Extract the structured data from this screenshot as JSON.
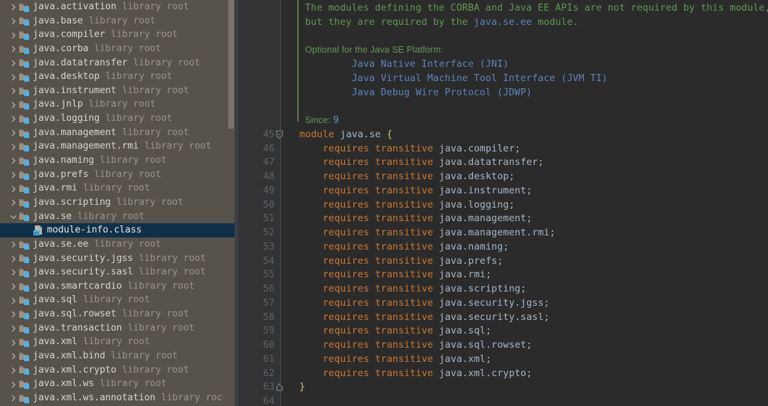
{
  "sidebar": {
    "tree": [
      {
        "name": "java.activation",
        "sub": "library root",
        "expanded": false,
        "icon": "library-root-icon",
        "selected": false,
        "child": false
      },
      {
        "name": "java.base",
        "sub": "library root",
        "expanded": false,
        "icon": "library-root-icon",
        "selected": false,
        "child": false
      },
      {
        "name": "java.compiler",
        "sub": "library root",
        "expanded": false,
        "icon": "library-root-icon",
        "selected": false,
        "child": false
      },
      {
        "name": "java.corba",
        "sub": "library root",
        "expanded": false,
        "icon": "library-root-icon",
        "selected": false,
        "child": false
      },
      {
        "name": "java.datatransfer",
        "sub": "library root",
        "expanded": false,
        "icon": "library-root-icon",
        "selected": false,
        "child": false
      },
      {
        "name": "java.desktop",
        "sub": "library root",
        "expanded": false,
        "icon": "library-root-icon",
        "selected": false,
        "child": false
      },
      {
        "name": "java.instrument",
        "sub": "library root",
        "expanded": false,
        "icon": "library-root-icon",
        "selected": false,
        "child": false
      },
      {
        "name": "java.jnlp",
        "sub": "library root",
        "expanded": false,
        "icon": "library-root-icon",
        "selected": false,
        "child": false
      },
      {
        "name": "java.logging",
        "sub": "library root",
        "expanded": false,
        "icon": "library-root-icon",
        "selected": false,
        "child": false
      },
      {
        "name": "java.management",
        "sub": "library root",
        "expanded": false,
        "icon": "library-root-icon",
        "selected": false,
        "child": false
      },
      {
        "name": "java.management.rmi",
        "sub": "library root",
        "expanded": false,
        "icon": "library-root-icon",
        "selected": false,
        "child": false
      },
      {
        "name": "java.naming",
        "sub": "library root",
        "expanded": false,
        "icon": "library-root-icon",
        "selected": false,
        "child": false
      },
      {
        "name": "java.prefs",
        "sub": "library root",
        "expanded": false,
        "icon": "library-root-icon",
        "selected": false,
        "child": false
      },
      {
        "name": "java.rmi",
        "sub": "library root",
        "expanded": false,
        "icon": "library-root-icon",
        "selected": false,
        "child": false
      },
      {
        "name": "java.scripting",
        "sub": "library root",
        "expanded": false,
        "icon": "library-root-icon",
        "selected": false,
        "child": false
      },
      {
        "name": "java.se",
        "sub": "library root",
        "expanded": true,
        "icon": "library-root-icon",
        "selected": false,
        "child": false
      },
      {
        "name": "module-info.class",
        "sub": "",
        "expanded": null,
        "icon": "class-file-icon",
        "selected": true,
        "child": true
      },
      {
        "name": "java.se.ee",
        "sub": "library root",
        "expanded": false,
        "icon": "library-root-icon",
        "selected": false,
        "child": false
      },
      {
        "name": "java.security.jgss",
        "sub": "library root",
        "expanded": false,
        "icon": "library-root-icon",
        "selected": false,
        "child": false
      },
      {
        "name": "java.security.sasl",
        "sub": "library root",
        "expanded": false,
        "icon": "library-root-icon",
        "selected": false,
        "child": false
      },
      {
        "name": "java.smartcardio",
        "sub": "library root",
        "expanded": false,
        "icon": "library-root-icon",
        "selected": false,
        "child": false
      },
      {
        "name": "java.sql",
        "sub": "library root",
        "expanded": false,
        "icon": "library-root-icon",
        "selected": false,
        "child": false
      },
      {
        "name": "java.sql.rowset",
        "sub": "library root",
        "expanded": false,
        "icon": "library-root-icon",
        "selected": false,
        "child": false
      },
      {
        "name": "java.transaction",
        "sub": "library root",
        "expanded": false,
        "icon": "library-root-icon",
        "selected": false,
        "child": false
      },
      {
        "name": "java.xml",
        "sub": "library root",
        "expanded": false,
        "icon": "library-root-icon",
        "selected": false,
        "child": false
      },
      {
        "name": "java.xml.bind",
        "sub": "library root",
        "expanded": false,
        "icon": "library-root-icon",
        "selected": false,
        "child": false
      },
      {
        "name": "java.xml.crypto",
        "sub": "library root",
        "expanded": false,
        "icon": "library-root-icon",
        "selected": false,
        "child": false
      },
      {
        "name": "java.xml.ws",
        "sub": "library root",
        "expanded": false,
        "icon": "library-root-icon",
        "selected": false,
        "child": false
      },
      {
        "name": "java.xml.ws.annotation",
        "sub": "library roc",
        "expanded": false,
        "icon": "library-root-icon",
        "selected": false,
        "child": false
      }
    ]
  },
  "editor": {
    "line_numbers": [
      "45",
      "46",
      "47",
      "48",
      "49",
      "50",
      "51",
      "52",
      "53",
      "54",
      "55",
      "56",
      "57",
      "58",
      "59",
      "60",
      "61",
      "62",
      "63",
      "64"
    ],
    "first_numbered_line": 45,
    "fold_markers": [
      {
        "line": 45,
        "type": "fold-start-icon"
      },
      {
        "line": 63,
        "type": "fold-end-icon"
      }
    ],
    "doc_lines": [
      {
        "indent": 1,
        "parts": [
          {
            "t": "The modules defining the CORBA and Java EE APIs are not required by this module,",
            "c": "doc"
          }
        ]
      },
      {
        "indent": 1,
        "parts": [
          {
            "t": "but they are required by the ",
            "c": "doc"
          },
          {
            "t": "java.se.ee",
            "c": "link"
          },
          {
            "t": " module.",
            "c": "doc"
          }
        ]
      },
      {
        "indent": 1,
        "parts": [
          {
            "t": "",
            "c": "doc"
          }
        ]
      },
      {
        "indent": 1,
        "parts": [
          {
            "t": "Optional for the Java SE Platform:",
            "c": "docsans"
          }
        ]
      },
      {
        "indent": 1,
        "parts": [
          {
            "t": "        ",
            "c": "doc"
          },
          {
            "t": "Java Native Interface (JNI)",
            "c": "link"
          }
        ]
      },
      {
        "indent": 1,
        "parts": [
          {
            "t": "        ",
            "c": "doc"
          },
          {
            "t": "Java Virtual Machine Tool Interface (JVM TI)",
            "c": "link"
          }
        ]
      },
      {
        "indent": 1,
        "parts": [
          {
            "t": "        ",
            "c": "doc"
          },
          {
            "t": "Java Debug Wire Protocol (JDWP)",
            "c": "link"
          }
        ]
      },
      {
        "indent": 1,
        "parts": [
          {
            "t": "",
            "c": "doc"
          }
        ]
      },
      {
        "indent": 1,
        "parts": [
          {
            "t": "Since: ",
            "c": "docsans"
          },
          {
            "t": "9",
            "c": "num"
          }
        ]
      }
    ],
    "code_lines": [
      {
        "num": "45",
        "parts": [
          {
            "t": "module",
            "c": "kw"
          },
          {
            "t": " ",
            "c": "plain"
          },
          {
            "t": "java.se",
            "c": "id"
          },
          {
            "t": " ",
            "c": "plain"
          },
          {
            "t": "{",
            "c": "brace"
          }
        ]
      },
      {
        "num": "46",
        "parts": [
          {
            "t": "    ",
            "c": "plain"
          },
          {
            "t": "requires transitive",
            "c": "kw"
          },
          {
            "t": " ",
            "c": "plain"
          },
          {
            "t": "java.compiler",
            "c": "id"
          },
          {
            "t": ";",
            "c": "id"
          }
        ]
      },
      {
        "num": "47",
        "parts": [
          {
            "t": "    ",
            "c": "plain"
          },
          {
            "t": "requires transitive",
            "c": "kw"
          },
          {
            "t": " ",
            "c": "plain"
          },
          {
            "t": "java.datatransfer",
            "c": "id"
          },
          {
            "t": ";",
            "c": "id"
          }
        ]
      },
      {
        "num": "48",
        "parts": [
          {
            "t": "    ",
            "c": "plain"
          },
          {
            "t": "requires transitive",
            "c": "kw"
          },
          {
            "t": " ",
            "c": "plain"
          },
          {
            "t": "java.desktop",
            "c": "id"
          },
          {
            "t": ";",
            "c": "id"
          }
        ]
      },
      {
        "num": "49",
        "parts": [
          {
            "t": "    ",
            "c": "plain"
          },
          {
            "t": "requires transitive",
            "c": "kw"
          },
          {
            "t": " ",
            "c": "plain"
          },
          {
            "t": "java.instrument",
            "c": "id"
          },
          {
            "t": ";",
            "c": "id"
          }
        ]
      },
      {
        "num": "50",
        "parts": [
          {
            "t": "    ",
            "c": "plain"
          },
          {
            "t": "requires transitive",
            "c": "kw"
          },
          {
            "t": " ",
            "c": "plain"
          },
          {
            "t": "java.logging",
            "c": "id"
          },
          {
            "t": ";",
            "c": "id"
          }
        ]
      },
      {
        "num": "51",
        "parts": [
          {
            "t": "    ",
            "c": "plain"
          },
          {
            "t": "requires transitive",
            "c": "kw"
          },
          {
            "t": " ",
            "c": "plain"
          },
          {
            "t": "java.management",
            "c": "id"
          },
          {
            "t": ";",
            "c": "id"
          }
        ]
      },
      {
        "num": "52",
        "parts": [
          {
            "t": "    ",
            "c": "plain"
          },
          {
            "t": "requires transitive",
            "c": "kw"
          },
          {
            "t": " ",
            "c": "plain"
          },
          {
            "t": "java.management.rmi",
            "c": "id"
          },
          {
            "t": ";",
            "c": "id"
          }
        ]
      },
      {
        "num": "53",
        "parts": [
          {
            "t": "    ",
            "c": "plain"
          },
          {
            "t": "requires transitive",
            "c": "kw"
          },
          {
            "t": " ",
            "c": "plain"
          },
          {
            "t": "java.naming",
            "c": "id"
          },
          {
            "t": ";",
            "c": "id"
          }
        ]
      },
      {
        "num": "54",
        "parts": [
          {
            "t": "    ",
            "c": "plain"
          },
          {
            "t": "requires transitive",
            "c": "kw"
          },
          {
            "t": " ",
            "c": "plain"
          },
          {
            "t": "java.prefs",
            "c": "id"
          },
          {
            "t": ";",
            "c": "id"
          }
        ]
      },
      {
        "num": "55",
        "parts": [
          {
            "t": "    ",
            "c": "plain"
          },
          {
            "t": "requires transitive",
            "c": "kw"
          },
          {
            "t": " ",
            "c": "plain"
          },
          {
            "t": "java.rmi",
            "c": "id"
          },
          {
            "t": ";",
            "c": "id"
          }
        ]
      },
      {
        "num": "56",
        "parts": [
          {
            "t": "    ",
            "c": "plain"
          },
          {
            "t": "requires transitive",
            "c": "kw"
          },
          {
            "t": " ",
            "c": "plain"
          },
          {
            "t": "java.scripting",
            "c": "id"
          },
          {
            "t": ";",
            "c": "id"
          }
        ]
      },
      {
        "num": "57",
        "parts": [
          {
            "t": "    ",
            "c": "plain"
          },
          {
            "t": "requires transitive",
            "c": "kw"
          },
          {
            "t": " ",
            "c": "plain"
          },
          {
            "t": "java.security.jgss",
            "c": "id"
          },
          {
            "t": ";",
            "c": "id"
          }
        ]
      },
      {
        "num": "58",
        "parts": [
          {
            "t": "    ",
            "c": "plain"
          },
          {
            "t": "requires transitive",
            "c": "kw"
          },
          {
            "t": " ",
            "c": "plain"
          },
          {
            "t": "java.security.sasl",
            "c": "id"
          },
          {
            "t": ";",
            "c": "id"
          }
        ]
      },
      {
        "num": "59",
        "parts": [
          {
            "t": "    ",
            "c": "plain"
          },
          {
            "t": "requires transitive",
            "c": "kw"
          },
          {
            "t": " ",
            "c": "plain"
          },
          {
            "t": "java.sql",
            "c": "id"
          },
          {
            "t": ";",
            "c": "id"
          }
        ]
      },
      {
        "num": "60",
        "parts": [
          {
            "t": "    ",
            "c": "plain"
          },
          {
            "t": "requires transitive",
            "c": "kw"
          },
          {
            "t": " ",
            "c": "plain"
          },
          {
            "t": "java.sql.rowset",
            "c": "id"
          },
          {
            "t": ";",
            "c": "id"
          }
        ]
      },
      {
        "num": "61",
        "parts": [
          {
            "t": "    ",
            "c": "plain"
          },
          {
            "t": "requires transitive",
            "c": "kw"
          },
          {
            "t": " ",
            "c": "plain"
          },
          {
            "t": "java.xml",
            "c": "id"
          },
          {
            "t": ";",
            "c": "id"
          }
        ]
      },
      {
        "num": "62",
        "parts": [
          {
            "t": "    ",
            "c": "plain"
          },
          {
            "t": "requires transitive",
            "c": "kw"
          },
          {
            "t": " ",
            "c": "plain"
          },
          {
            "t": "java.xml.crypto",
            "c": "id"
          },
          {
            "t": ";",
            "c": "id"
          }
        ]
      },
      {
        "num": "63",
        "parts": [
          {
            "t": "}",
            "c": "brace"
          }
        ]
      },
      {
        "num": "64",
        "parts": [
          {
            "t": "",
            "c": "plain"
          }
        ]
      }
    ]
  },
  "colors": {
    "sidebar_bg": "#57524a",
    "sidebar_selection": "#10304a",
    "editor_bg": "#2b2b2b",
    "gutter_bg": "#313335",
    "line_number": "#606366",
    "keyword": "#cc7832",
    "identifier": "#a9b7c6",
    "doc_comment": "#629755",
    "doc_link": "#5c84bd",
    "brace": "#d6c96b",
    "number": "#6897bb",
    "icon_accent": "#4db2e8",
    "scrollbar_thumb": "#7a746a"
  }
}
